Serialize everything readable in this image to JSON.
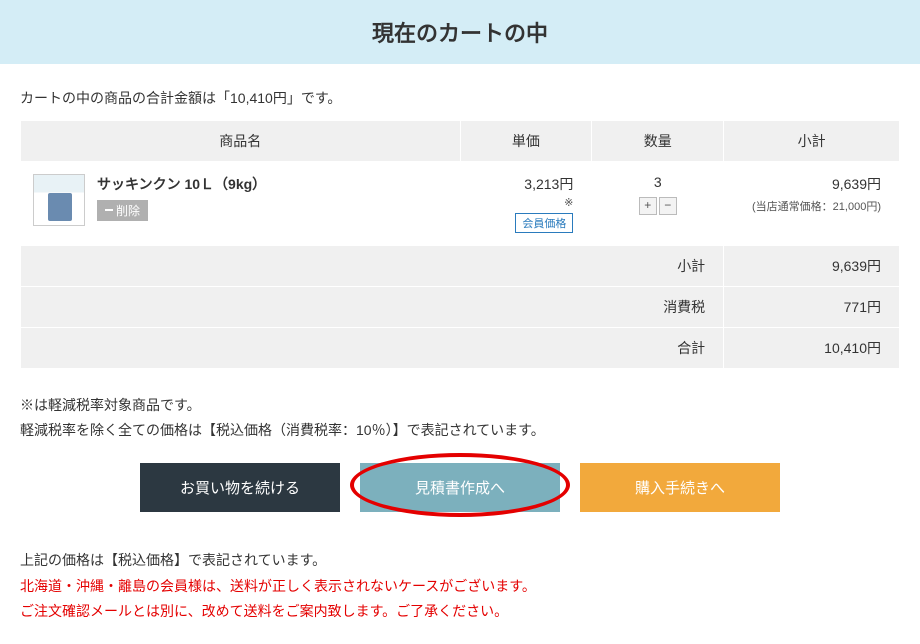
{
  "page_title": "現在のカートの中",
  "total_line_prefix": "カートの中の商品の合計金額は「",
  "total_line_amount": "10,410円",
  "total_line_suffix": "」です。",
  "headers": {
    "name": "商品名",
    "unit_price": "単価",
    "qty": "数量",
    "subtotal": "小計"
  },
  "item": {
    "name": "サッキンクン 10Ｌ（9kg）",
    "delete_label": "削除",
    "unit_price": "3,213円",
    "price_mark": "※",
    "member_badge": "会員価格",
    "quantity": "3",
    "subtotal": "9,639円",
    "orig_price_label": "(当店通常価格：21,000円)"
  },
  "summary": {
    "subtotal_label": "小計",
    "subtotal_value": "9,639円",
    "tax_label": "消費税",
    "tax_value": "771円",
    "total_label": "合計",
    "total_value": "10,410円"
  },
  "note1": "※は軽減税率対象商品です。",
  "note2": "軽減税率を除く全ての価格は【税込価格（消費税率：10％）】で表記されています。",
  "buttons": {
    "continue": "お買い物を続ける",
    "quote": "見積書作成へ",
    "checkout": "購入手続きへ"
  },
  "footer": {
    "line1": "上記の価格は【税込価格】で表記されています。",
    "line2": "北海道・沖縄・離島の会員様は、送料が正しく表示されないケースがございます。",
    "line3": "ご注文確認メールとは別に、改めて送料をご案内致します。ご了承ください。"
  }
}
